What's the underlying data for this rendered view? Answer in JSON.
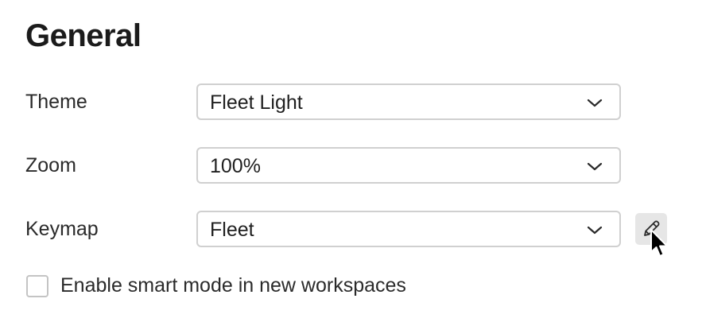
{
  "section": {
    "title": "General"
  },
  "settings": {
    "theme": {
      "label": "Theme",
      "value": "Fleet Light"
    },
    "zoom": {
      "label": "Zoom",
      "value": "100%"
    },
    "keymap": {
      "label": "Keymap",
      "value": "Fleet",
      "edit_icon": "pencil-icon"
    }
  },
  "smart_mode": {
    "label": "Enable smart mode in new workspaces",
    "checked": false
  },
  "icons": {
    "dropdown": "chevron-down-icon",
    "cursor": "mouse-pointer-icon"
  },
  "colors": {
    "border": "#d0d0d0",
    "text": "#1f1f1f",
    "edit_button_bg": "#e6e6e6"
  }
}
